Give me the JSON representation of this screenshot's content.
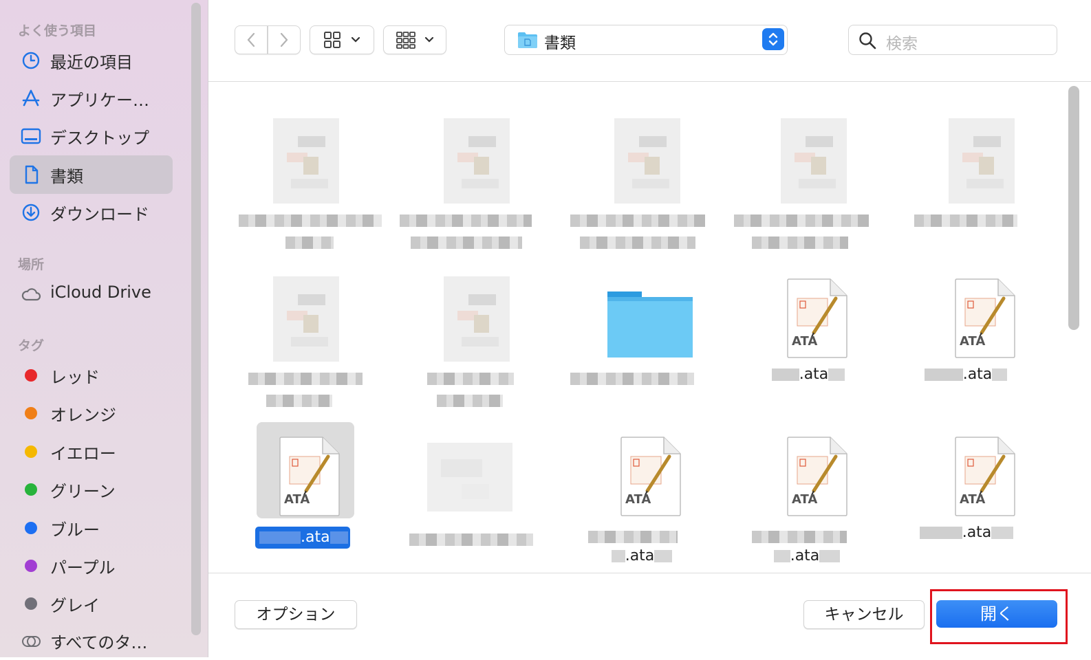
{
  "sidebar": {
    "sections": [
      {
        "heading": "よく使う項目"
      },
      {
        "heading": "場所"
      },
      {
        "heading": "タグ"
      }
    ],
    "favorites": [
      {
        "label": "最近の項目",
        "icon": "clock-icon"
      },
      {
        "label": "アプリケー…",
        "icon": "apps-icon"
      },
      {
        "label": "デスクトップ",
        "icon": "desktop-icon"
      },
      {
        "label": "書類",
        "icon": "document-icon",
        "active": true
      },
      {
        "label": "ダウンロード",
        "icon": "download-icon"
      }
    ],
    "locations": [
      {
        "label": "iCloud Drive",
        "icon": "cloud-icon"
      }
    ],
    "tags": [
      {
        "label": "レッド",
        "color": "#e8282b"
      },
      {
        "label": "オレンジ",
        "color": "#f07f17"
      },
      {
        "label": "イエロー",
        "color": "#f5b800"
      },
      {
        "label": "グリーン",
        "color": "#28b33b"
      },
      {
        "label": "ブルー",
        "color": "#1d6ff2"
      },
      {
        "label": "パープル",
        "color": "#a23ed3"
      },
      {
        "label": "グレイ",
        "color": "#717079"
      },
      {
        "label": "すべてのタ…",
        "icon": "all-tags-icon"
      }
    ]
  },
  "toolbar": {
    "location": "書類",
    "search_placeholder": "検索"
  },
  "files": {
    "ata_label": "ATA",
    "selected_name": ".ata",
    "row2_names": [
      ".ata",
      ".ata"
    ],
    "row3_names": [
      ".ata",
      ".ata",
      ".ata"
    ]
  },
  "footer": {
    "options_label": "オプション",
    "cancel_label": "キャンセル",
    "open_label": "開く"
  },
  "colors": {
    "accent": "#1a6ff0",
    "highlight": "#e0141e",
    "folder": "#5cc0f2"
  }
}
